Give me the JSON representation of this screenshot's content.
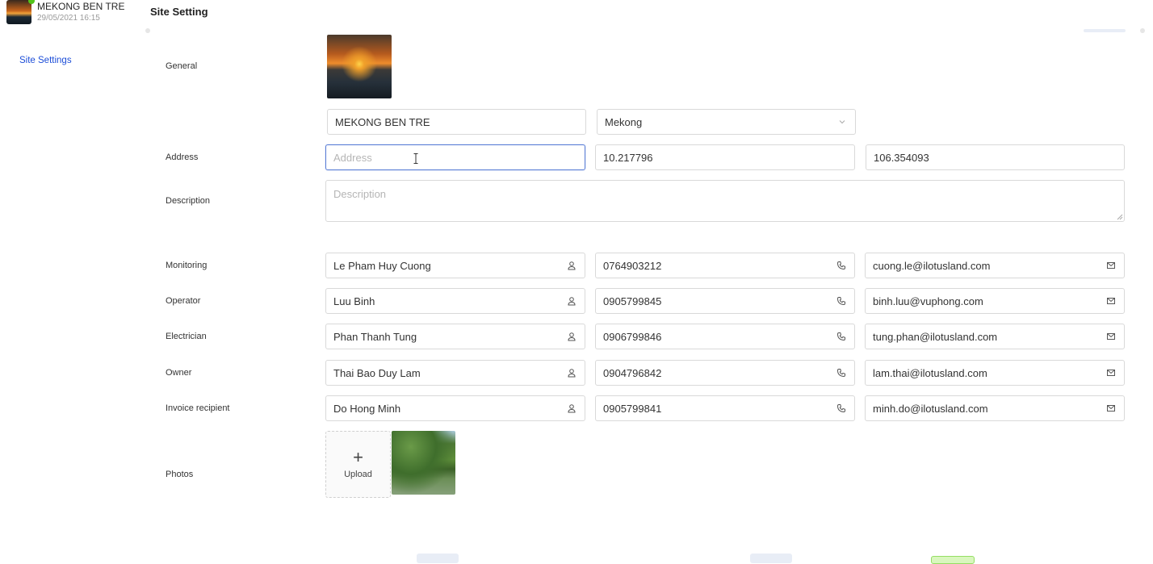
{
  "sidebar": {
    "site_name": "MEKONG BEN TRE",
    "site_date": "29/05/2021 16:15",
    "nav": [
      {
        "label": "Site Settings"
      }
    ]
  },
  "header": {
    "title": "Site Setting"
  },
  "general": {
    "label": "General",
    "site_name_value": "MEKONG BEN TRE",
    "region_value": "Mekong"
  },
  "address": {
    "label": "Address",
    "placeholder": "Address",
    "latitude": "10.217796",
    "longitude": "106.354093"
  },
  "description": {
    "label": "Description",
    "placeholder": "Description"
  },
  "contacts": [
    {
      "role": "Monitoring",
      "name": "Le Pham Huy Cuong",
      "phone": "0764903212",
      "email": "cuong.le@ilotusland.com"
    },
    {
      "role": "Operator",
      "name": "Luu Binh",
      "phone": "0905799845",
      "email": "binh.luu@vuphong.com"
    },
    {
      "role": "Electrician",
      "name": "Phan Thanh Tung",
      "phone": "0906799846",
      "email": "tung.phan@ilotusland.com"
    },
    {
      "role": "Owner",
      "name": "Thai Bao Duy Lam",
      "phone": "0904796842",
      "email": "lam.thai@ilotusland.com"
    },
    {
      "role": "Invoice recipient",
      "name": "Do Hong Minh",
      "phone": "0905799841",
      "email": "minh.do@ilotusland.com"
    }
  ],
  "photos": {
    "label": "Photos",
    "upload_label": "Upload"
  },
  "icons": {
    "person": "user-icon",
    "phone": "phone-icon",
    "email": "mail-icon",
    "dropdown": "chevron-down-icon"
  },
  "colors": {
    "accent": "#1d4ed8",
    "focus_border": "#5b7fd6",
    "online": "#52c41a"
  }
}
